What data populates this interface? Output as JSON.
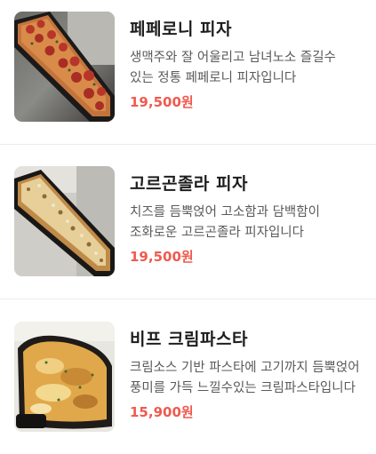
{
  "menu": {
    "items": [
      {
        "name": "페페로니 피자",
        "description": "생맥주와 잘 어울리고 남녀노소 즐길수 있는 정통 페페로니 피자입니다",
        "price": "19,500원",
        "image_icon": "pepperoni-pizza-photo"
      },
      {
        "name": "고르곤졸라 피자",
        "description": "치즈를 듬뿍얹어 고소함과 담백함이 조화로운 고르곤졸라 피자입니다",
        "price": "19,500원",
        "image_icon": "gorgonzola-pizza-photo"
      },
      {
        "name": "비프 크림파스타",
        "description": "크림소스 기반 파스타에 고기까지 듬뿍얹어 풍미를 가득 느낄수있는 크림파스타입니다",
        "price": "15,900원",
        "image_icon": "beef-cream-pasta-photo"
      }
    ]
  },
  "colors": {
    "price": "#f05a4f",
    "title": "#1d1d1d",
    "description": "#5a5a5a",
    "divider": "#ececec"
  }
}
